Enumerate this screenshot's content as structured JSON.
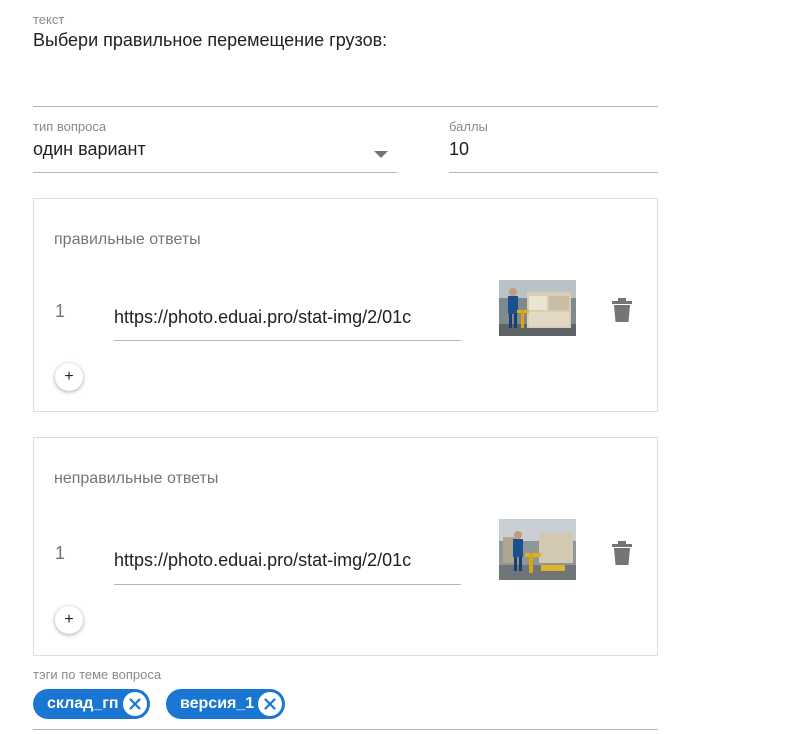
{
  "text_field": {
    "label": "текст",
    "value": "Выбери правильное перемещение грузов:"
  },
  "question_type": {
    "label": "тип вопроса",
    "value": "один вариант"
  },
  "points": {
    "label": "баллы",
    "value": "10"
  },
  "correct_answers": {
    "title": "правильные ответы",
    "items": [
      {
        "number": "1",
        "url": "https://photo.eduai.pro/stat-img/2/01c"
      }
    ],
    "add_label": "+"
  },
  "wrong_answers": {
    "title": "неправильные ответы",
    "items": [
      {
        "number": "1",
        "url": "https://photo.eduai.pro/stat-img/2/01c"
      }
    ],
    "add_label": "+"
  },
  "tags": {
    "label": "тэги по теме вопроса",
    "items": [
      "склад_гп",
      "версия_1"
    ]
  },
  "colors": {
    "accent": "#1976d2",
    "trash": "#757575"
  },
  "icons": {
    "dropdown": "caret-down-icon",
    "delete": "trash-icon",
    "add": "plus-icon",
    "chip_remove": "close-circle-icon"
  }
}
